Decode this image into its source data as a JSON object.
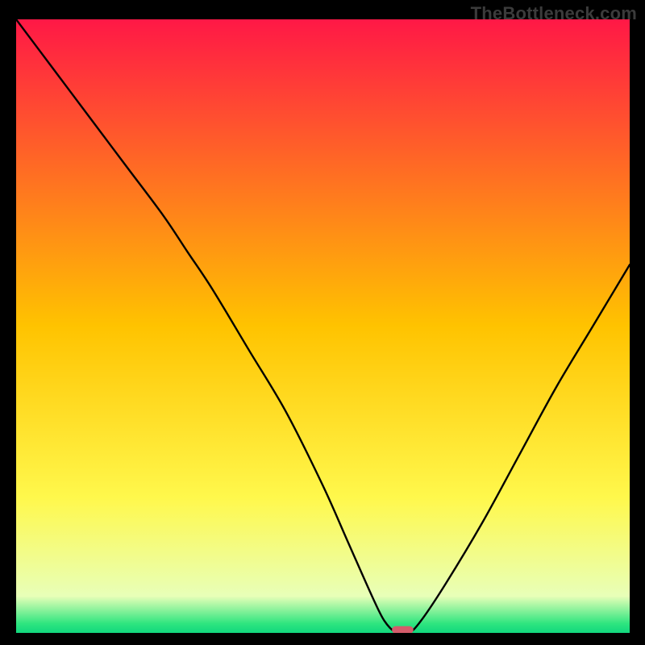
{
  "watermark": "TheBottleneck.com",
  "chart_data": {
    "type": "line",
    "title": "",
    "xlabel": "",
    "ylabel": "",
    "xlim": [
      0,
      100
    ],
    "ylim": [
      0,
      100
    ],
    "grid": false,
    "legend": false,
    "background_gradient_stops": [
      {
        "offset": 0.0,
        "color": "#ff1846"
      },
      {
        "offset": 0.5,
        "color": "#ffc300"
      },
      {
        "offset": 0.78,
        "color": "#fff84c"
      },
      {
        "offset": 0.94,
        "color": "#e8ffb8"
      },
      {
        "offset": 0.985,
        "color": "#2ee57f"
      },
      {
        "offset": 1.0,
        "color": "#11d77e"
      }
    ],
    "series": [
      {
        "name": "bottleneck-curve",
        "x": [
          0,
          6,
          12,
          18,
          24,
          28,
          32,
          38,
          44,
          50,
          54,
          58,
          60,
          62,
          64,
          66,
          70,
          76,
          82,
          88,
          94,
          100
        ],
        "y": [
          100,
          92,
          84,
          76,
          68,
          62,
          56,
          46,
          36,
          24,
          15,
          6,
          2,
          0,
          0,
          2,
          8,
          18,
          29,
          40,
          50,
          60
        ]
      }
    ],
    "marker": {
      "name": "optimal-pill",
      "x": 63,
      "y": 0.5,
      "width_pct": 3.5,
      "height_pct": 1.2,
      "color": "#d45c6b"
    }
  }
}
